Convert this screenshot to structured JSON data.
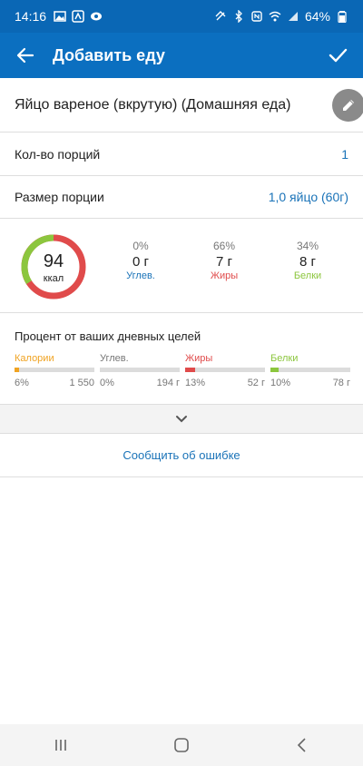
{
  "status_bar": {
    "time": "14:16",
    "battery": "64%"
  },
  "app_bar": {
    "title": "Добавить еду"
  },
  "food": {
    "name": "Яйцо вареное (вкрутую) (Домашняя еда)"
  },
  "servings": {
    "label": "Кол-во порций",
    "value": "1"
  },
  "serving_size": {
    "label": "Размер порции",
    "value": "1,0 яйцо (60г)"
  },
  "nutrition": {
    "calories": "94",
    "calories_unit": "ккал",
    "macros": [
      {
        "pct": "0%",
        "grams": "0 г",
        "label": "Углев.",
        "color": "#1a73b8"
      },
      {
        "pct": "66%",
        "grams": "7 г",
        "label": "Жиры",
        "color": "#e04b4b"
      },
      {
        "pct": "34%",
        "grams": "8 г",
        "label": "Белки",
        "color": "#8cc63e"
      }
    ]
  },
  "daily_goals": {
    "title": "Процент от ваших дневных целей",
    "items": [
      {
        "label": "Калории",
        "pct": "6%",
        "goal": "1 550",
        "fraction": 0.06,
        "color": "#f0a322"
      },
      {
        "label": "Углев.",
        "pct": "0%",
        "goal": "194 г",
        "fraction": 0.0,
        "color": "#1a73b8"
      },
      {
        "label": "Жиры",
        "pct": "13%",
        "goal": "52 г",
        "fraction": 0.13,
        "color": "#e04b4b"
      },
      {
        "label": "Белки",
        "pct": "10%",
        "goal": "78 г",
        "fraction": 0.1,
        "color": "#8cc63e"
      }
    ]
  },
  "report": {
    "label": "Сообщить об ошибке"
  },
  "colors": {
    "primary": "#0b6fc0",
    "status": "#0a67b5",
    "link": "#1a73b8"
  }
}
